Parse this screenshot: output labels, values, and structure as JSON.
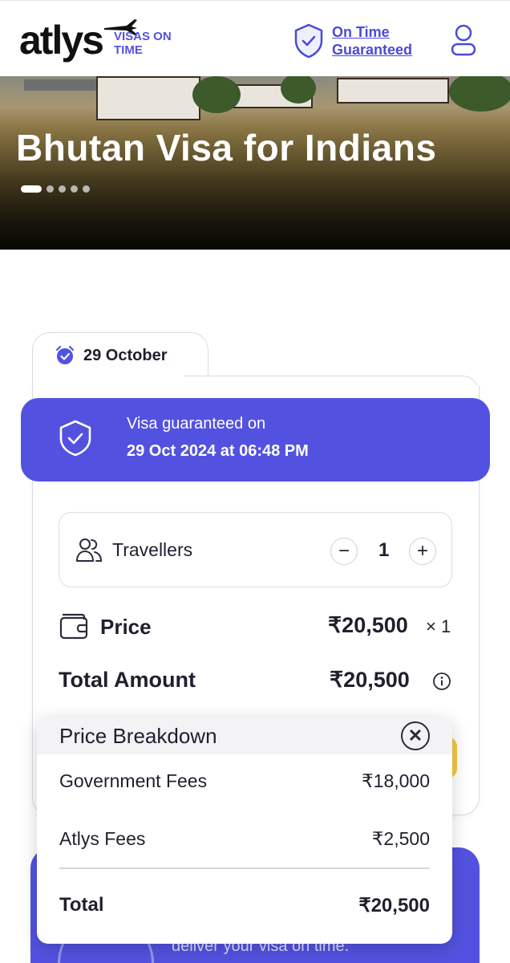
{
  "header": {
    "logo_text": "atlys",
    "logo_tagline": "VISAS ON TIME",
    "on_time_line1": "On Time",
    "on_time_line2": "Guaranteed"
  },
  "hero": {
    "title": "Bhutan Visa for Indians",
    "slides_total": 5,
    "active_slide": 1
  },
  "card": {
    "tab_date": "29 October",
    "guarantee_line1": "Visa guaranteed on",
    "guarantee_line2": "29 Oct 2024 at 06:48 PM",
    "travellers_label": "Travellers",
    "travellers_count": "1",
    "minus_symbol": "−",
    "plus_symbol": "+",
    "price_label": "Price",
    "price_value": "₹20,500",
    "price_multiplier": "× 1",
    "total_label": "Total Amount",
    "total_value": "₹20,500"
  },
  "breakdown": {
    "title": "Price Breakdown",
    "close_symbol": "✕",
    "rows": [
      {
        "label": "Government Fees",
        "value": "₹18,000"
      },
      {
        "label": "Atlys Fees",
        "value": "₹2,500"
      }
    ],
    "total_label": "Total",
    "total_value": "₹20,500"
  },
  "bottom": {
    "text_fragment": "deliver your visa on time."
  },
  "colors": {
    "brand_purple": "#5352e0",
    "accent_yellow": "#f4c84a"
  }
}
